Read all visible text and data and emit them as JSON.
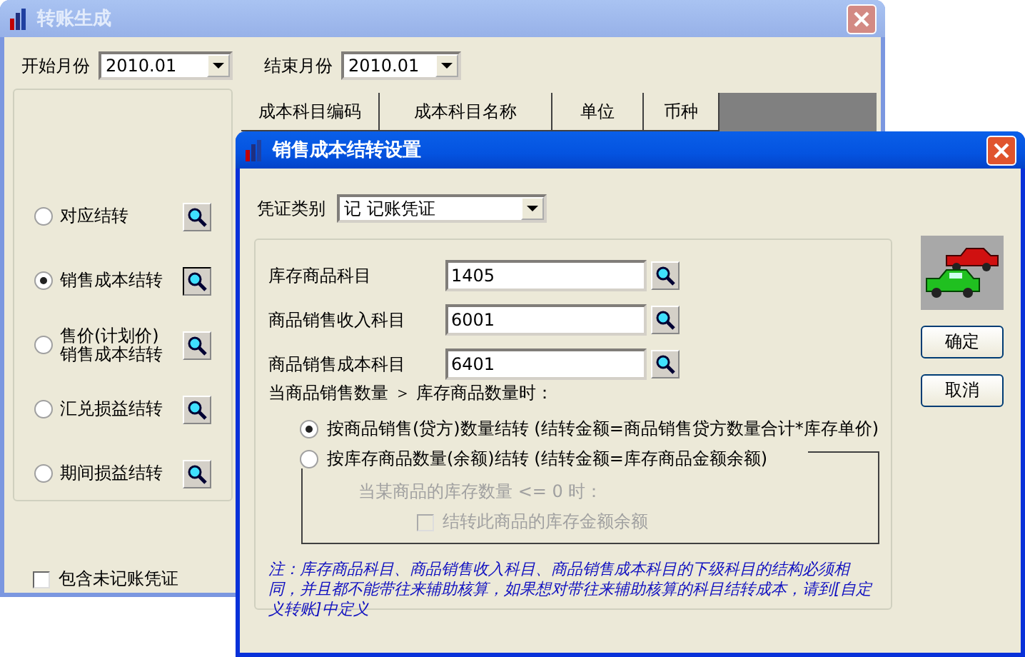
{
  "main_window": {
    "title": "转账生成",
    "start_month": {
      "label": "开始月份",
      "value": "2010.01"
    },
    "end_month": {
      "label": "结束月份",
      "value": "2010.01"
    },
    "transfer_types": [
      {
        "label": "对应结转",
        "selected": false
      },
      {
        "label": "销售成本结转",
        "selected": true
      },
      {
        "label": "售价(计划价)\n销售成本结转",
        "selected": false
      },
      {
        "label": "汇兑损益结转",
        "selected": false
      },
      {
        "label": "期间损益结转",
        "selected": false
      }
    ],
    "table": {
      "columns": [
        "成本科目编码",
        "成本科目名称",
        "单位",
        "币种"
      ]
    },
    "include_unposted": {
      "label": "包含未记账凭证",
      "checked": false
    }
  },
  "dialog": {
    "title": "销售成本结转设置",
    "voucher_type": {
      "label": "凭证类别",
      "value": "记 记账凭证"
    },
    "fields": [
      {
        "label": "库存商品科目",
        "value": "1405"
      },
      {
        "label": "商品销售收入科目",
        "value": "6001"
      },
      {
        "label": "商品销售成本科目",
        "value": "6401"
      }
    ],
    "condition": "当商品销售数量 ＞ 库存商品数量时：",
    "methods": [
      {
        "label": "按商品销售(贷方)数量结转  (结转金额=商品销售贷方数量合计*库存单价)",
        "selected": true
      },
      {
        "label": "按库存商品数量(余额)结转  (结转金额=库存商品金额余额)",
        "selected": false
      }
    ],
    "sub_option": {
      "disabled": true,
      "condition": "当某商品的库存数量 <= 0 时：",
      "checkbox": {
        "label": "结转此商品的库存金额余额",
        "checked": false
      }
    },
    "note": "注：库存商品科目、商品销售收入科目、商品销售成本科目的下级科目的结构必须相同，并且都不能带往来辅助核算，如果想对带往来辅助核算的科目结转成本，请到[自定义转账]中定义",
    "buttons": [
      "确定",
      "取消"
    ]
  }
}
